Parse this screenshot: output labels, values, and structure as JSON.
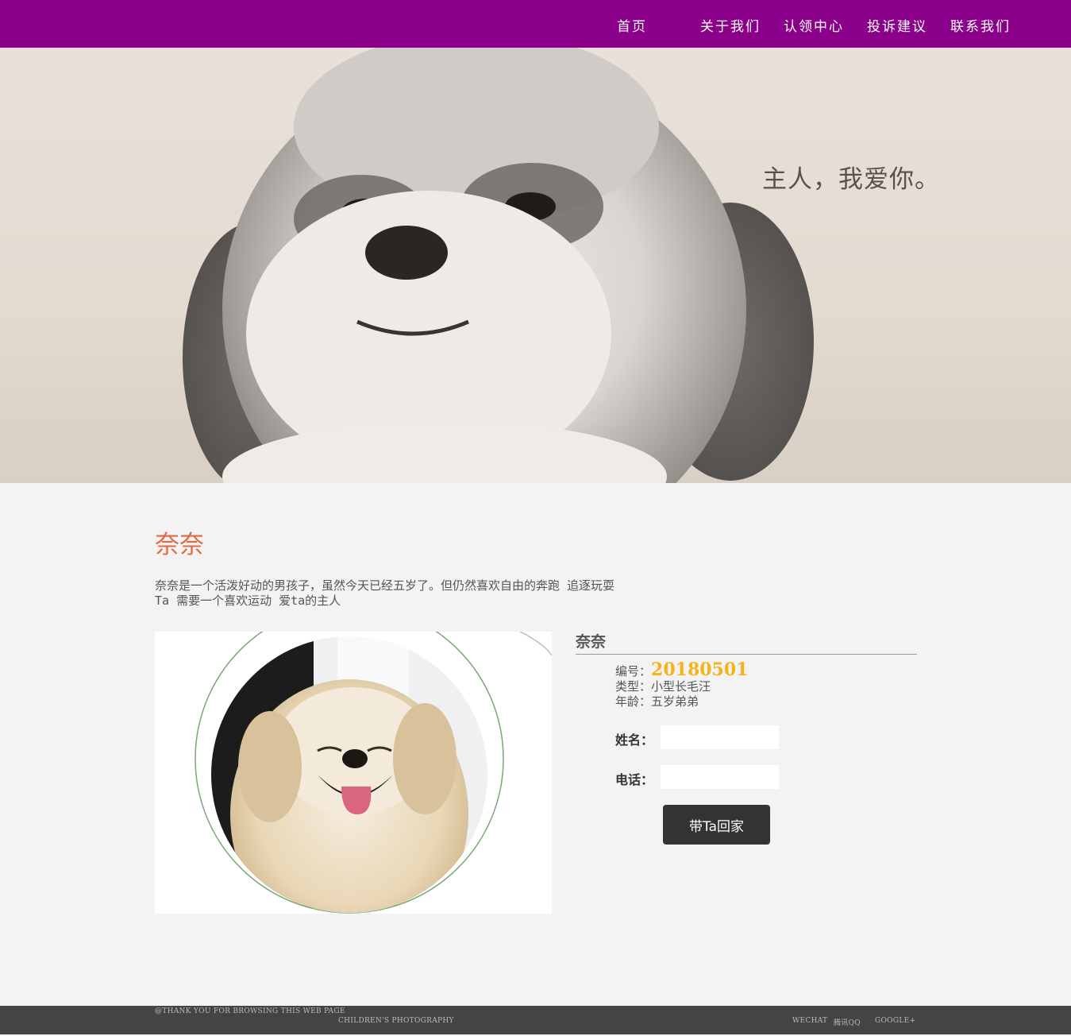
{
  "nav": {
    "items": [
      {
        "label": "首页"
      },
      {
        "label": "关于我们"
      },
      {
        "label": "认领中心"
      },
      {
        "label": "投诉建议"
      },
      {
        "label": "联系我们"
      }
    ],
    "background": "#8b008b"
  },
  "hero": {
    "caption": "主人，我爱你。"
  },
  "pet": {
    "title": "奈奈",
    "desc_line1": "奈奈是一个活泼好动的男孩子，虽然今天已经五岁了。但仍然喜欢自由的奔跑 追逐玩耍",
    "desc_line2": "Ta 需要一个喜欢运动 爱ta的主人",
    "name": "奈奈",
    "id_label": "编号：",
    "id_value": "20180501",
    "type_label": "类型：",
    "type_value": "小型长毛汪",
    "age_label": "年龄：",
    "age_value": "五岁弟弟"
  },
  "form": {
    "name_label": "姓名：",
    "name_value": "",
    "phone_label": "电话：",
    "phone_value": "",
    "submit_label": "带Ta回家"
  },
  "footer": {
    "left1": "@THANK YOU FOR BROWSING THIS WEB PAGE",
    "left2": "CHILDREN'S PHOTOGRAPHY",
    "links": [
      "WECHAT",
      "腾讯QQ",
      "GOOGLE+"
    ]
  },
  "colors": {
    "title_accent": "#e06a45",
    "id_accent": "#f5b21b",
    "footer_bg": "#444444"
  }
}
